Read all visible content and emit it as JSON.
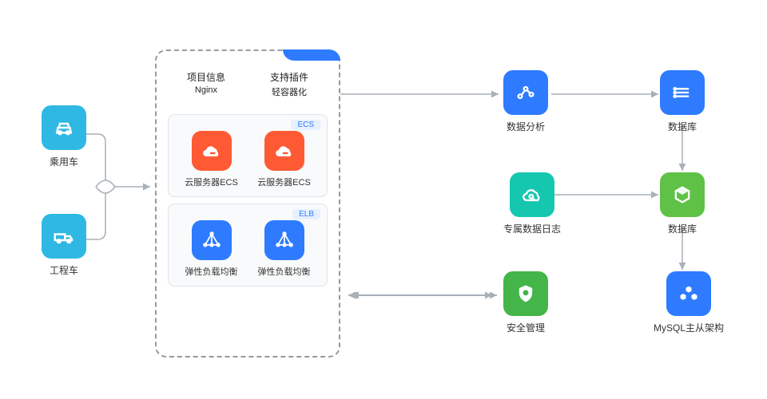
{
  "left": {
    "car": {
      "label": "乘用车"
    },
    "truck": {
      "label": "工程车"
    }
  },
  "center": {
    "headers": [
      {
        "t1": "项目信息",
        "t2": "Nginx"
      },
      {
        "t1": "支持插件",
        "t2": "轻容器化"
      }
    ],
    "ecs": {
      "badge": "ECS",
      "item_label": "云服务器ECS"
    },
    "elb": {
      "badge": "ELB",
      "item_label": "弹性负载均衡"
    }
  },
  "right": {
    "analytics": {
      "label": "数据分析"
    },
    "db1": {
      "label": "数据库"
    },
    "logs": {
      "label": "专属数据日志"
    },
    "db2": {
      "label": "数据库"
    },
    "security": {
      "label": "安全管理"
    },
    "mysql": {
      "label": "MySQL主从架构"
    }
  },
  "colors": {
    "cyan": "#2fb8e3",
    "blue": "#2e7bff",
    "orange": "#ff5a34",
    "teal": "#16c7b0",
    "green": "#5fc246",
    "green2": "#44b549"
  }
}
